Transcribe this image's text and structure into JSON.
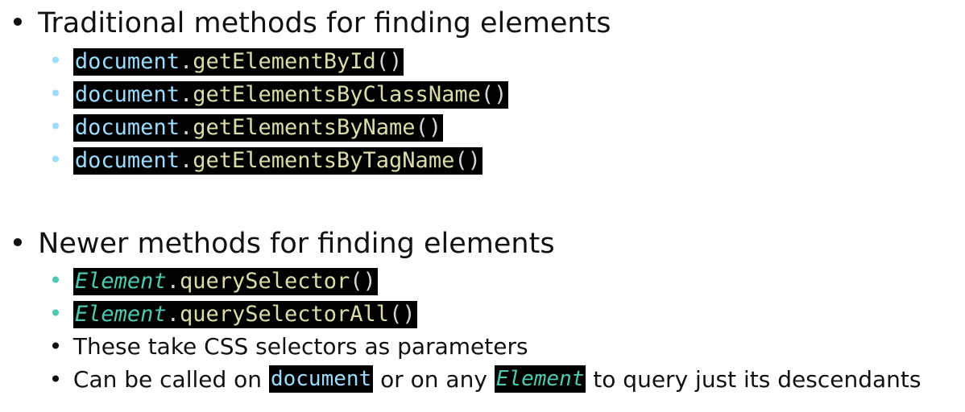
{
  "slide": {
    "section1": {
      "heading": "Traditional methods for finding elements",
      "items": [
        {
          "object": "document",
          "dot": ".",
          "method": "getElementById",
          "parens": "()"
        },
        {
          "object": "document",
          "dot": ".",
          "method": "getElementsByClassName",
          "parens": "()"
        },
        {
          "object": "document",
          "dot": ".",
          "method": "getElementsByName",
          "parens": "()"
        },
        {
          "object": "document",
          "dot": ".",
          "method": "getElementsByTagName",
          "parens": "()"
        }
      ]
    },
    "section2": {
      "heading": "Newer methods for finding elements",
      "items": [
        {
          "object": "Element",
          "dot": ".",
          "method": "querySelector",
          "parens": "()"
        },
        {
          "object": "Element",
          "dot": ".",
          "method": "querySelectorAll",
          "parens": "()"
        }
      ],
      "note1": "These take CSS selectors as parameters",
      "note2": {
        "before": "Can be called on",
        "code1": "document",
        "middle": "or on any",
        "code2": "Element",
        "after": "to query just its descendants"
      }
    }
  },
  "colors": {
    "code_bg": "#000000",
    "keyword_document": "#9cdcfe",
    "method": "#dcdcaa",
    "element_type": "#4ec9b0",
    "bullet_blue": "#9cdcfe",
    "bullet_teal": "#4ec9b0"
  }
}
